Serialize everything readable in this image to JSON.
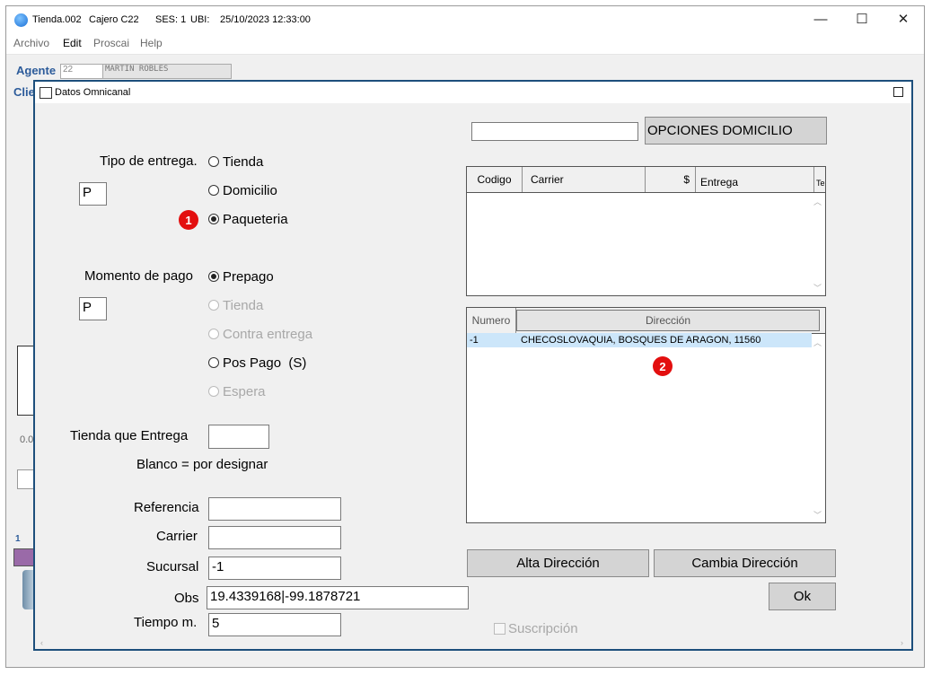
{
  "window": {
    "title": "Tienda.002",
    "cashier": "Cajero C22",
    "session": "SES: 1",
    "location": "UBI:",
    "datetime": "25/10/2023 12:33:00",
    "minimize": "—",
    "maximize": "☐",
    "close": "✕"
  },
  "menu": [
    "Archivo",
    "Edit",
    "Proscai",
    "Help"
  ],
  "agent": {
    "label": "Agente",
    "code": "22",
    "name": "MARTIN ROBLES"
  },
  "background": {
    "client_label": "Clie",
    "value1": "0.0",
    "item1": "1"
  },
  "dialog": {
    "title": "Datos Omnicanal",
    "tipo_entrega": {
      "label": "Tipo de entrega.",
      "code": "P",
      "options": [
        "Tienda",
        "Domicilio",
        "Paqueteria"
      ],
      "selected": "Paqueteria"
    },
    "momento_pago": {
      "label": "Momento de pago",
      "code": "P",
      "options": [
        "Prepago",
        "Tienda",
        "Contra entrega",
        "Pos Pago  (S)",
        "Espera"
      ],
      "selected": "Prepago"
    },
    "tienda_entrega": {
      "label": "Tienda que Entrega",
      "value": "",
      "hint": "Blanco = por designar"
    },
    "referencia": {
      "label": "Referencia",
      "value": ""
    },
    "carrier": {
      "label": "Carrier",
      "value": ""
    },
    "sucursal": {
      "label": "Sucursal",
      "value": "-1"
    },
    "obs": {
      "label": "Obs",
      "value": "19.4339168|-99.1878721"
    },
    "tiempo": {
      "label": "Tiempo m.",
      "value": "5"
    },
    "search_value": "",
    "opciones_button": "OPCIONES DOMICILIO",
    "carrier_table": {
      "columns": [
        "Codigo",
        "Carrier",
        "$",
        "Entrega",
        "Te"
      ]
    },
    "address_table": {
      "columns": [
        "Numero",
        "Dirección"
      ],
      "rows": [
        {
          "numero": "-1",
          "direccion": "CHECOSLOVAQUIA, BOSQUES DE ARAGON, 11560"
        }
      ]
    },
    "alta_button": "Alta Dirección",
    "cambia_button": "Cambia Dirección",
    "ok_button": "Ok",
    "suscripcion": "Suscripción"
  },
  "annotations": [
    "1",
    "2"
  ]
}
